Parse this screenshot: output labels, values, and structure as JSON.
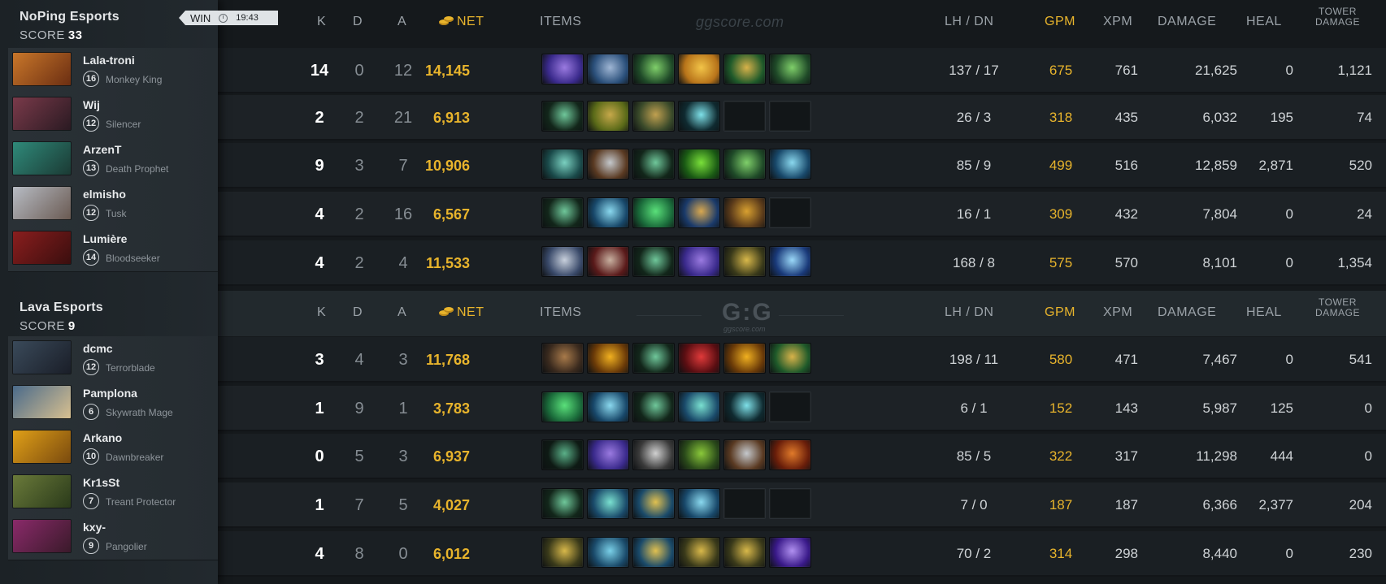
{
  "watermark": "ggscore.com",
  "logo": {
    "text": "G:G",
    "sub": "ggscore.com"
  },
  "headers": {
    "k": "K",
    "d": "D",
    "a": "A",
    "net": "NET",
    "items": "ITEMS",
    "lhdn": "LH  /  DN",
    "gpm": "GPM",
    "xpm": "XPM",
    "damage": "DAMAGE",
    "heal": "HEAL",
    "tower_line1": "TOWER",
    "tower_line2": "DAMAGE"
  },
  "result": {
    "label": "WIN",
    "time": "19:43"
  },
  "teams": [
    {
      "name": "NoPing Esports",
      "score_label": "SCORE",
      "score": "33",
      "players": [
        {
          "name": "Lala-troni",
          "level": "16",
          "hero": "Monkey King",
          "portrait": [
            "#c9772a",
            "#6b2e12"
          ],
          "k": "14",
          "d": "0",
          "a": "12",
          "net": "14,145",
          "lhdn": "137  /  17",
          "gpm": "675",
          "xpm": "761",
          "damage": "21,625",
          "heal": "0",
          "tower": "1,121",
          "items": [
            {
              "c1": "#3a2a8c",
              "c2": "#9a7ae0"
            },
            {
              "c1": "#2a4f7a",
              "c2": "#9fb6d4"
            },
            {
              "c1": "#1f4a28",
              "c2": "#7fcf6a"
            },
            {
              "c1": "#b8741a",
              "c2": "#f2c448"
            },
            {
              "c1": "#1f5a2a",
              "c2": "#d8b24a"
            },
            {
              "c1": "#1f4a28",
              "c2": "#7fcf6a"
            }
          ]
        },
        {
          "name": "Wij",
          "level": "12",
          "hero": "Silencer",
          "portrait": [
            "#7a3a4a",
            "#2a1a22"
          ],
          "k": "2",
          "d": "2",
          "a": "21",
          "net": "6,913",
          "lhdn": "26  /  3",
          "gpm": "318",
          "xpm": "435",
          "damage": "6,032",
          "heal": "195",
          "tower": "74",
          "items": [
            {
              "c1": "#12261a",
              "c2": "#6fc79a"
            },
            {
              "c1": "#5a6a18",
              "c2": "#c6a84a"
            },
            {
              "c1": "#3a4a2a",
              "c2": "#c0a050"
            },
            {
              "c1": "#0f2a30",
              "c2": "#7ee0e8"
            },
            {
              "empty": true
            },
            {
              "empty": true
            }
          ]
        },
        {
          "name": "ArzenT",
          "level": "13",
          "hero": "Death Prophet",
          "portrait": [
            "#2f8a7a",
            "#1b3a34"
          ],
          "k": "9",
          "d": "3",
          "a": "7",
          "net": "10,906",
          "lhdn": "85  /  9",
          "gpm": "499",
          "xpm": "516",
          "damage": "12,859",
          "heal": "2,871",
          "tower": "520",
          "items": [
            {
              "c1": "#1a4a4a",
              "c2": "#7ad0c0"
            },
            {
              "c1": "#5a3a22",
              "c2": "#c4c8cc"
            },
            {
              "c1": "#12261a",
              "c2": "#6fc79a"
            },
            {
              "c1": "#1a5a14",
              "c2": "#7ae03a"
            },
            {
              "c1": "#1f4a28",
              "c2": "#7fcf6a"
            },
            {
              "c1": "#18486a",
              "c2": "#8ad8ee"
            }
          ]
        },
        {
          "name": "elmisho",
          "level": "12",
          "hero": "Tusk",
          "portrait": [
            "#b7bcc4",
            "#6a5a52"
          ],
          "k": "4",
          "d": "2",
          "a": "16",
          "net": "6,567",
          "lhdn": "16  /  1",
          "gpm": "309",
          "xpm": "432",
          "damage": "7,804",
          "heal": "0",
          "tower": "24",
          "items": [
            {
              "c1": "#12261a",
              "c2": "#6fc79a"
            },
            {
              "c1": "#18486a",
              "c2": "#8ad8ee"
            },
            {
              "c1": "#1a6a3a",
              "c2": "#5ae07a"
            },
            {
              "c1": "#1a3a6a",
              "c2": "#d8a850"
            },
            {
              "c1": "#5a3a1a",
              "c2": "#d8a030"
            },
            {
              "empty": true
            }
          ]
        },
        {
          "name": "Lumière",
          "level": "14",
          "hero": "Bloodseeker",
          "portrait": [
            "#8a1e1e",
            "#3a0e0e"
          ],
          "k": "4",
          "d": "2",
          "a": "4",
          "net": "11,533",
          "lhdn": "168  /  8",
          "gpm": "575",
          "xpm": "570",
          "damage": "8,101",
          "heal": "0",
          "tower": "1,354",
          "items": [
            {
              "c1": "#3a4a6a",
              "c2": "#c8d0dc"
            },
            {
              "c1": "#5a1a1a",
              "c2": "#c8b0a0"
            },
            {
              "c1": "#12261a",
              "c2": "#6fc79a"
            },
            {
              "c1": "#3a2a8c",
              "c2": "#9a7ae0"
            },
            {
              "c1": "#3a3a1a",
              "c2": "#d8b84a"
            },
            {
              "c1": "#1a3a7a",
              "c2": "#9ad8f8"
            }
          ]
        }
      ]
    },
    {
      "name": "Lava Esports",
      "score_label": "SCORE",
      "score": "9",
      "players": [
        {
          "name": "dcmc",
          "level": "12",
          "hero": "Terrorblade",
          "portrait": [
            "#3a4a5a",
            "#1a1e28"
          ],
          "k": "3",
          "d": "4",
          "a": "3",
          "net": "11,768",
          "lhdn": "198  /  11",
          "gpm": "580",
          "xpm": "471",
          "damage": "7,467",
          "heal": "0",
          "tower": "541",
          "items": [
            {
              "c1": "#3a2a1e",
              "c2": "#a87a4a"
            },
            {
              "c1": "#6a3a08",
              "c2": "#f0b020"
            },
            {
              "c1": "#12261a",
              "c2": "#6fc79a"
            },
            {
              "c1": "#5a0e12",
              "c2": "#e03a3a"
            },
            {
              "c1": "#6a3a08",
              "c2": "#f0b020"
            },
            {
              "c1": "#1f5a2a",
              "c2": "#d8b24a"
            }
          ]
        },
        {
          "name": "Pamplona",
          "level": "6",
          "hero": "Skywrath Mage",
          "portrait": [
            "#4a6a8a",
            "#d8c090"
          ],
          "k": "1",
          "d": "9",
          "a": "1",
          "net": "3,783",
          "lhdn": "6  /  1",
          "gpm": "152",
          "xpm": "143",
          "damage": "5,987",
          "heal": "125",
          "tower": "0",
          "items": [
            {
              "c1": "#1a6a3a",
              "c2": "#5ae07a"
            },
            {
              "c1": "#18486a",
              "c2": "#8ad8ee"
            },
            {
              "c1": "#12261a",
              "c2": "#6fc79a"
            },
            {
              "c1": "#1a4a6a",
              "c2": "#7ae0d0"
            },
            {
              "c1": "#0f2a30",
              "c2": "#7ee0e8"
            },
            {
              "empty": true
            }
          ]
        },
        {
          "name": "Arkano",
          "level": "10",
          "hero": "Dawnbreaker",
          "portrait": [
            "#e0a018",
            "#7a4a0e"
          ],
          "k": "0",
          "d": "5",
          "a": "3",
          "net": "6,937",
          "lhdn": "85  /  5",
          "gpm": "322",
          "xpm": "317",
          "damage": "11,298",
          "heal": "444",
          "tower": "0",
          "items": [
            {
              "c1": "#0e1a14",
              "c2": "#5ab088"
            },
            {
              "c1": "#3a2a8c",
              "c2": "#9a7ae0"
            },
            {
              "c1": "#3a3a3a",
              "c2": "#d0d0d0"
            },
            {
              "c1": "#2a4a1a",
              "c2": "#8ac83a"
            },
            {
              "c1": "#5a3a22",
              "c2": "#c4c8cc"
            },
            {
              "c1": "#6a1e0a",
              "c2": "#e07a2a"
            }
          ]
        },
        {
          "name": "Kr1sSt",
          "level": "7",
          "hero": "Treant Protector",
          "portrait": [
            "#6a7a3a",
            "#2a3a1a"
          ],
          "k": "1",
          "d": "7",
          "a": "5",
          "net": "4,027",
          "lhdn": "7  /  0",
          "gpm": "187",
          "xpm": "187",
          "damage": "6,366",
          "heal": "2,377",
          "tower": "204",
          "items": [
            {
              "c1": "#12261a",
              "c2": "#6fc79a"
            },
            {
              "c1": "#1a4a6a",
              "c2": "#7ae0d0"
            },
            {
              "c1": "#1a4a6a",
              "c2": "#e0c050"
            },
            {
              "c1": "#18486a",
              "c2": "#8ad8ee"
            },
            {
              "empty": true
            },
            {
              "empty": true
            }
          ]
        },
        {
          "name": "kxy-",
          "level": "9",
          "hero": "Pangolier",
          "portrait": [
            "#8a2a6a",
            "#3a1a2a"
          ],
          "k": "4",
          "d": "8",
          "a": "0",
          "net": "6,012",
          "lhdn": "70  /  2",
          "gpm": "314",
          "xpm": "298",
          "damage": "8,440",
          "heal": "0",
          "tower": "230",
          "items": [
            {
              "c1": "#3a3a1a",
              "c2": "#d8b84a"
            },
            {
              "c1": "#1a4a6a",
              "c2": "#7ad0e8"
            },
            {
              "c1": "#1a4a6a",
              "c2": "#e0c050"
            },
            {
              "c1": "#3a3a1a",
              "c2": "#d8b84a"
            },
            {
              "c1": "#3a3a1a",
              "c2": "#d8b84a"
            },
            {
              "c1": "#3a1a8a",
              "c2": "#b090f0"
            }
          ]
        }
      ]
    }
  ]
}
